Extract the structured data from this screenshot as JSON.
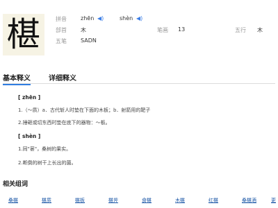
{
  "entry": {
    "character": "椹",
    "pinyin_label": "拼音",
    "pinyin": [
      "zhēn",
      "shèn"
    ],
    "radical_label": "部首",
    "radical": "木",
    "strokes_label": "笔画",
    "strokes": "13",
    "wuxing_label": "五行",
    "wuxing": "木",
    "wubi_label": "五笔",
    "wubi": "SADN"
  },
  "tabs": {
    "basic": "基本释义",
    "detail": "详细释义"
  },
  "definitions": [
    {
      "kind": "pinyin",
      "text": "[ zhēn ]"
    },
    {
      "kind": "def",
      "text": "1.（～质）a．古代斩人时垫在下面的木板；b．射箭用的靶子"
    },
    {
      "kind": "def",
      "text": "2.捶砸或切东西时垫在底下的器物：～板。"
    },
    {
      "kind": "pinyin",
      "text": "[ shèn ]"
    },
    {
      "kind": "def",
      "text": "1.同\"葚\"，桑树的果实。"
    },
    {
      "kind": "def",
      "text": "2.断倒的树干上长出的菌。"
    }
  ],
  "related": {
    "title": "相关组词",
    "words": [
      "桑椹",
      "椹质",
      "椹板",
      "椹斧",
      "食椹",
      "木椹",
      "红椹",
      "桑椹酒",
      "更"
    ]
  },
  "icons": {
    "speaker": "speaker-icon"
  },
  "colors": {
    "accent": "#2f7de1",
    "speaker": "#3c7ee6",
    "link": "#1f5aa8",
    "char_bg": "#f6f3e4"
  }
}
